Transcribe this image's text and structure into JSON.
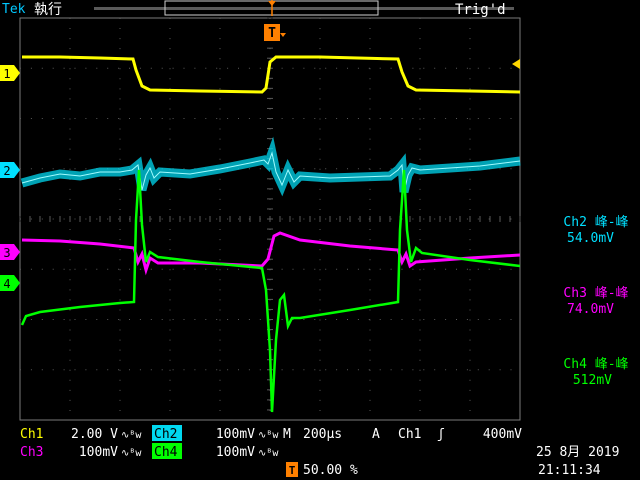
{
  "header": {
    "brand": "Tek",
    "run_state": "執行",
    "trigger_status": "Trig'd",
    "trigger_marker": "T"
  },
  "channel_markers": [
    {
      "id": "1",
      "color": "#ffff00"
    },
    {
      "id": "2",
      "color": "#00e0ff"
    },
    {
      "id": "3",
      "color": "#ff00ff"
    },
    {
      "id": "4",
      "color": "#00ff00"
    }
  ],
  "measurements": [
    {
      "label": "Ch2 峰-峰",
      "value": "54.0mV",
      "color": "#00e0ff"
    },
    {
      "label": "Ch3 峰-峰",
      "value": "74.0mV",
      "color": "#ff00ff"
    },
    {
      "label": "Ch4 峰-峰",
      "value": "512mV",
      "color": "#00ff00"
    }
  ],
  "bottom": {
    "ch1": {
      "label": "Ch1",
      "value": "2.00 V",
      "color": "#ffff00"
    },
    "ch2": {
      "label": "Ch2",
      "value": "100mV",
      "color": "#00e0ff"
    },
    "ch3": {
      "label": "Ch3",
      "value": "100mV",
      "color": "#ff00ff"
    },
    "ch4": {
      "label": "Ch4",
      "value": "100mV",
      "color": "#00ff00"
    },
    "bw_symbol": "∿ᴮw",
    "timebase_label": "M",
    "timebase_value": "200µs",
    "trigger_type": "A",
    "trigger_source": "Ch1",
    "trigger_slope": "ʃ",
    "trigger_level": "400mV",
    "trigger_position": "50.00 %",
    "date": "25 8月  2019",
    "time": "21:11:34"
  }
}
